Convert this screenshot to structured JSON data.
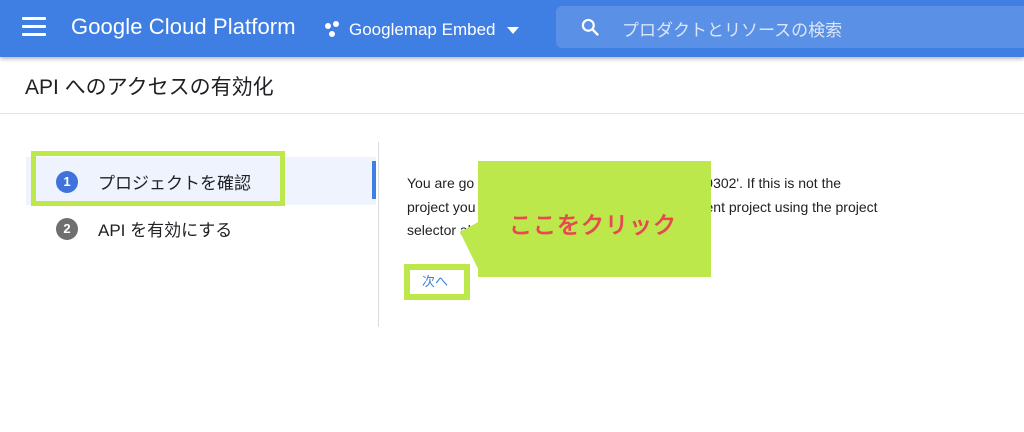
{
  "header": {
    "app_title": "Google Cloud Platform",
    "project_name": "Googlemap Embed",
    "search_placeholder": "プロダクトとリソースの検索",
    "bar_color": "#3f7ee2"
  },
  "page": {
    "title": "API へのアクセスの有効化"
  },
  "steps": [
    {
      "number": "1",
      "label": "プロジェクトを確認",
      "active": true
    },
    {
      "number": "2",
      "label": "API を有効にする",
      "active": false
    }
  ],
  "content": {
    "line1": "You are go                                   ilful-wording-329302'. If this is not the",
    "line2": "project you                                   r create a different project using the project",
    "line3": "selector ab",
    "next_label": "次へ"
  },
  "callout": {
    "text": "ここをクリック",
    "box_color": "#bde84b",
    "text_color": "#e8484f"
  },
  "icons": [
    "menu-icon",
    "search-icon",
    "project-icon",
    "dropdown-caret-icon"
  ]
}
